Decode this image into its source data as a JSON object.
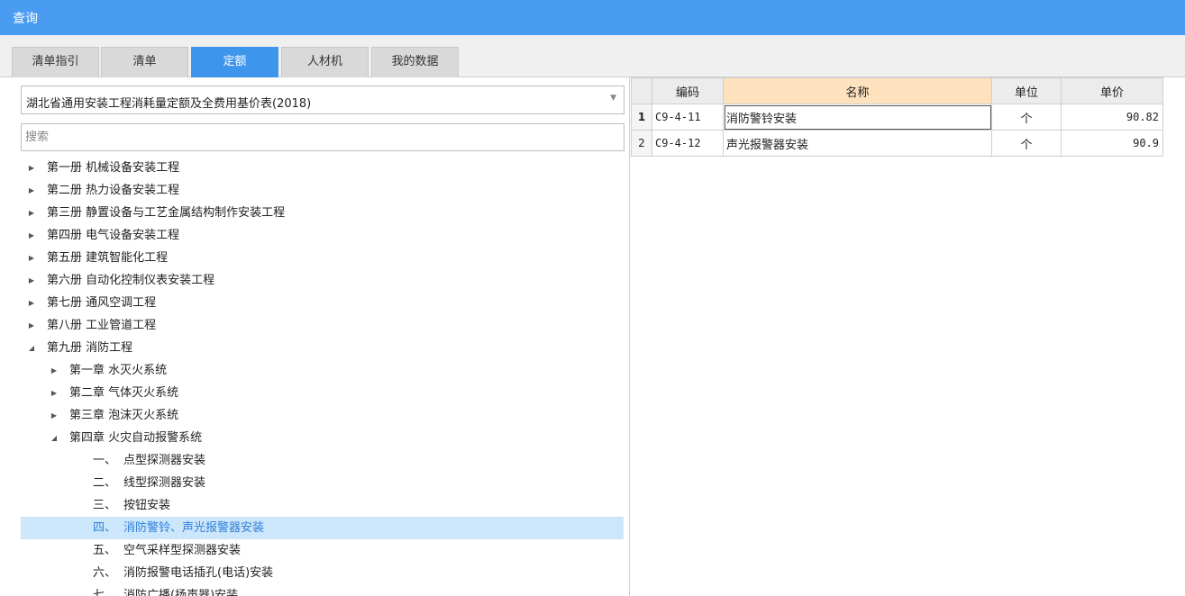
{
  "window": {
    "title": "查询"
  },
  "tabs": [
    {
      "label": "清单指引",
      "active": false
    },
    {
      "label": "清单",
      "active": false
    },
    {
      "label": "定额",
      "active": true
    },
    {
      "label": "人材机",
      "active": false
    },
    {
      "label": "我的数据",
      "active": false
    }
  ],
  "library_select": {
    "value": "湖北省通用安装工程消耗量定额及全费用基价表(2018)"
  },
  "search": {
    "placeholder": "搜索",
    "value": ""
  },
  "tree": {
    "volumes": [
      "第一册 机械设备安装工程",
      "第二册 热力设备安装工程",
      "第三册 静置设备与工艺金属结构制作安装工程",
      "第四册 电气设备安装工程",
      "第五册 建筑智能化工程",
      "第六册 自动化控制仪表安装工程",
      "第七册 通风空调工程",
      "第八册 工业管道工程",
      "第九册 消防工程"
    ],
    "chapters": [
      "第一章 水灭火系统",
      "第二章 气体灭火系统",
      "第三章 泡沫灭火系统",
      "第四章 火灾自动报警系统"
    ],
    "sections": [
      {
        "num": "一、",
        "label": "点型探测器安装",
        "selected": false
      },
      {
        "num": "二、",
        "label": "线型探测器安装",
        "selected": false
      },
      {
        "num": "三、",
        "label": "按钮安装",
        "selected": false
      },
      {
        "num": "四、",
        "label": "消防警铃、声光报警器安装",
        "selected": true
      },
      {
        "num": "五、",
        "label": "空气采样型探测器安装",
        "selected": false
      },
      {
        "num": "六、",
        "label": "消防报警电话插孔(电话)安装",
        "selected": false
      },
      {
        "num": "七、",
        "label": "消防广播(扬声器)安装",
        "selected": false
      }
    ]
  },
  "grid": {
    "headers": {
      "code": "编码",
      "name": "名称",
      "unit": "单位",
      "price": "单价"
    },
    "rows": [
      {
        "index": "1",
        "code": "C9-4-11",
        "name": "消防警铃安装",
        "unit": "个",
        "price": "90.82"
      },
      {
        "index": "2",
        "code": "C9-4-12",
        "name": "声光报警器安装",
        "unit": "个",
        "price": "90.9"
      }
    ]
  },
  "colors": {
    "titlebar": "#4a9cf2",
    "tab_active": "#3d95ec",
    "tree_selected_bg": "#cce6fb",
    "header_highlight": "#fde2bd"
  },
  "icons": {
    "collapsed": "triangle-right-icon",
    "expanded": "triangle-down-icon",
    "dropdown": "chevron-down-icon"
  }
}
